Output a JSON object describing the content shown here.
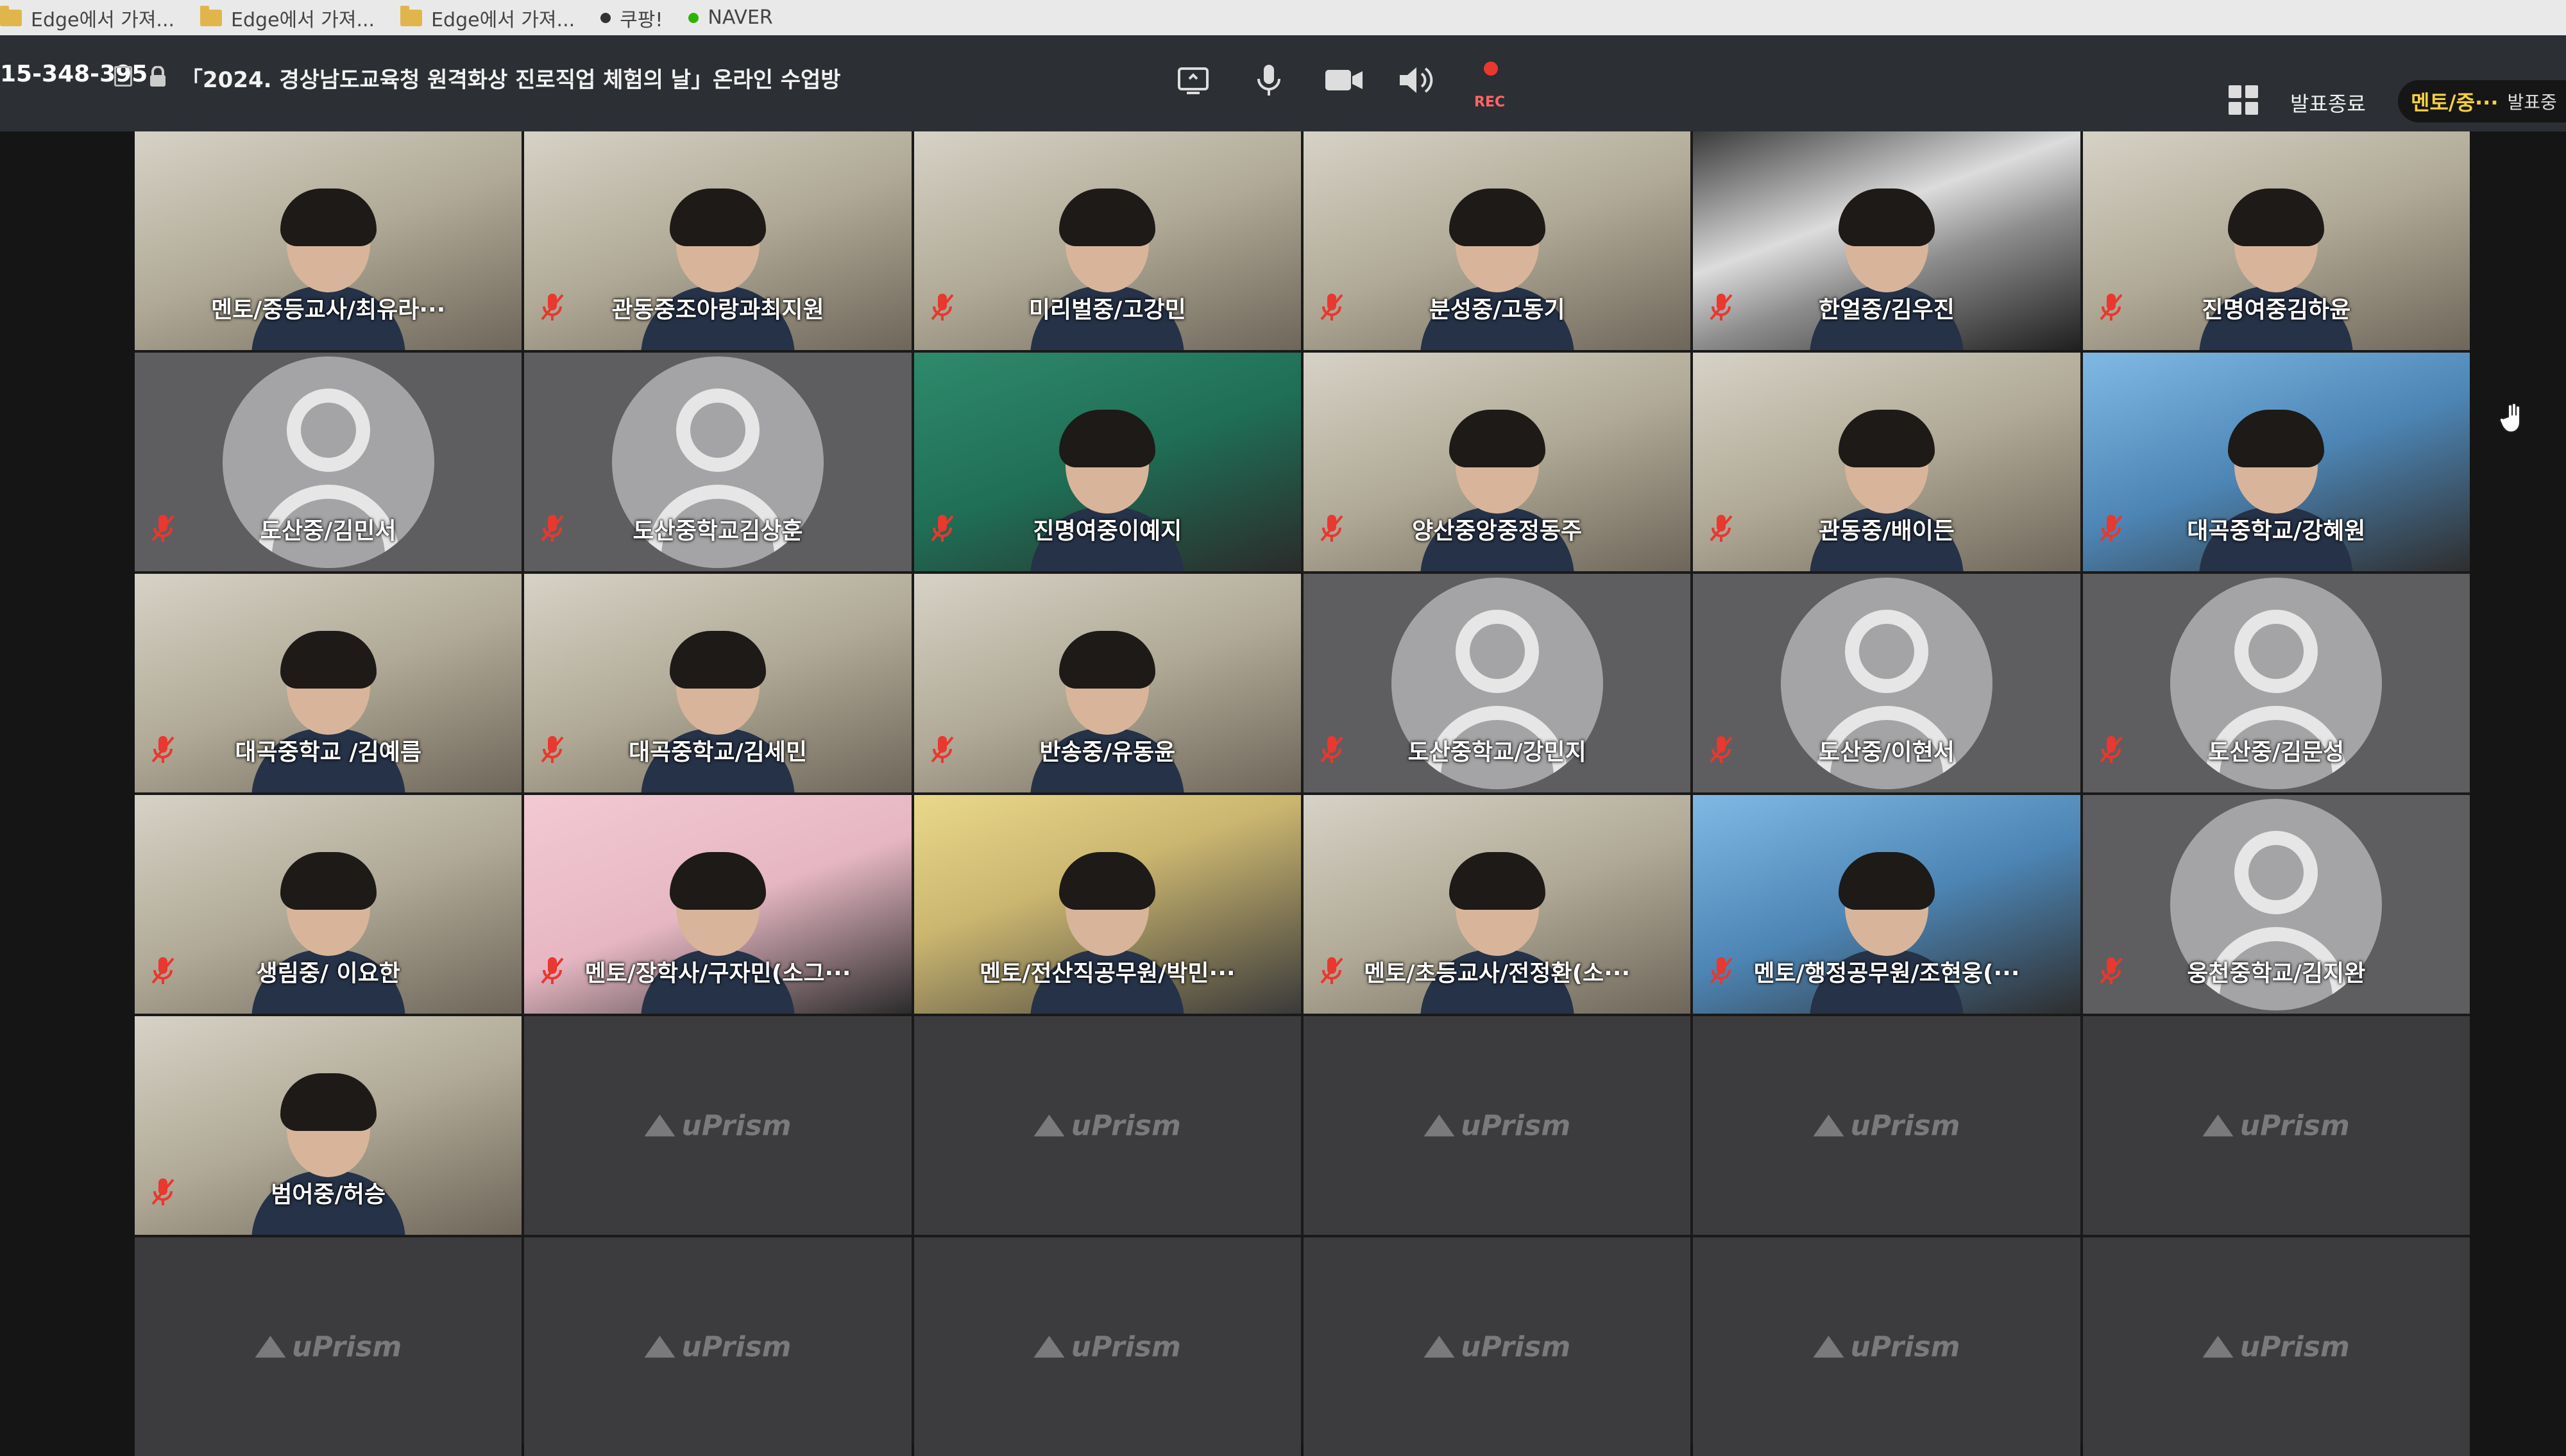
{
  "bookmarks": [
    {
      "label": "Edge에서 가져...",
      "icon": "folder-icon"
    },
    {
      "label": "Edge에서 가져...",
      "icon": "folder-icon"
    },
    {
      "label": "Edge에서 가져...",
      "icon": "folder-icon"
    },
    {
      "label": "쿠팡!",
      "icon": "coupang-icon"
    },
    {
      "label": "NAVER",
      "icon": "naver-icon"
    }
  ],
  "meeting": {
    "id": "15-348-395",
    "title": "「2024. 경상남도교육청 원격화상 진로직업 체험의 날」온라인 수업방",
    "rec_label": "REC",
    "end_presentation_label": "발표종료",
    "mentor_pill_name": "멘토/중···",
    "mentor_pill_status": "발표중"
  },
  "colors": {
    "topbar_bg": "#2c2f33",
    "mute_red": "#e8382f",
    "mentor_yellow": "#f4d03f"
  },
  "participants": [
    {
      "name": "멘토/중등교사/최유라···",
      "muted": false,
      "type": "camera",
      "style": "room"
    },
    {
      "name": "관동중조아랑과최지원",
      "muted": true,
      "type": "camera",
      "style": "room"
    },
    {
      "name": "미리벌중/고강민",
      "muted": true,
      "type": "camera",
      "style": "room"
    },
    {
      "name": "분성중/고동기",
      "muted": true,
      "type": "camera",
      "style": "room"
    },
    {
      "name": "한얼중/김우진",
      "muted": true,
      "type": "camera",
      "style": "dark"
    },
    {
      "name": "진명여중김하윤",
      "muted": true,
      "type": "camera",
      "style": "room"
    },
    {
      "name": "도산중/김민서",
      "muted": true,
      "type": "avatar",
      "style": ""
    },
    {
      "name": "도산중학교김상훈",
      "muted": true,
      "type": "avatar",
      "style": ""
    },
    {
      "name": "진명여중이예지",
      "muted": true,
      "type": "camera",
      "style": "green"
    },
    {
      "name": "양산중앙중정동주",
      "muted": true,
      "type": "camera",
      "style": "room"
    },
    {
      "name": "관동중/배이든",
      "muted": true,
      "type": "camera",
      "style": "room"
    },
    {
      "name": "대곡중학교/강혜원",
      "muted": true,
      "type": "camera",
      "style": "blue"
    },
    {
      "name": "대곡중학교 /김예름",
      "muted": true,
      "type": "camera",
      "style": "room"
    },
    {
      "name": "대곡중학교/김세민",
      "muted": true,
      "type": "camera",
      "style": "room"
    },
    {
      "name": "반송중/유동윤",
      "muted": true,
      "type": "camera",
      "style": "room"
    },
    {
      "name": "도산중학교/강민지",
      "muted": true,
      "type": "avatar",
      "style": ""
    },
    {
      "name": "도산중/이현서",
      "muted": true,
      "type": "avatar",
      "style": ""
    },
    {
      "name": "도산중/김문성",
      "muted": true,
      "type": "avatar",
      "style": ""
    },
    {
      "name": "생림중/ 이요한",
      "muted": true,
      "type": "camera",
      "style": "room"
    },
    {
      "name": "멘토/장학사/구자민(소그···",
      "muted": true,
      "type": "camera",
      "style": "pink"
    },
    {
      "name": "멘토/전산직공무원/박민···",
      "muted": false,
      "type": "camera",
      "style": "yellow"
    },
    {
      "name": "멘토/초등교사/전정환(소···",
      "muted": true,
      "type": "camera",
      "style": "room"
    },
    {
      "name": "멘토/행정공무원/조현웅(···",
      "muted": true,
      "type": "camera",
      "style": "blue"
    },
    {
      "name": "웅천중학교/김지완",
      "muted": true,
      "type": "avatar",
      "style": ""
    },
    {
      "name": "범어중/허승",
      "muted": true,
      "type": "camera",
      "style": "room"
    }
  ],
  "empty_slot_brand": "uPrism",
  "empty_slot_count": 11
}
